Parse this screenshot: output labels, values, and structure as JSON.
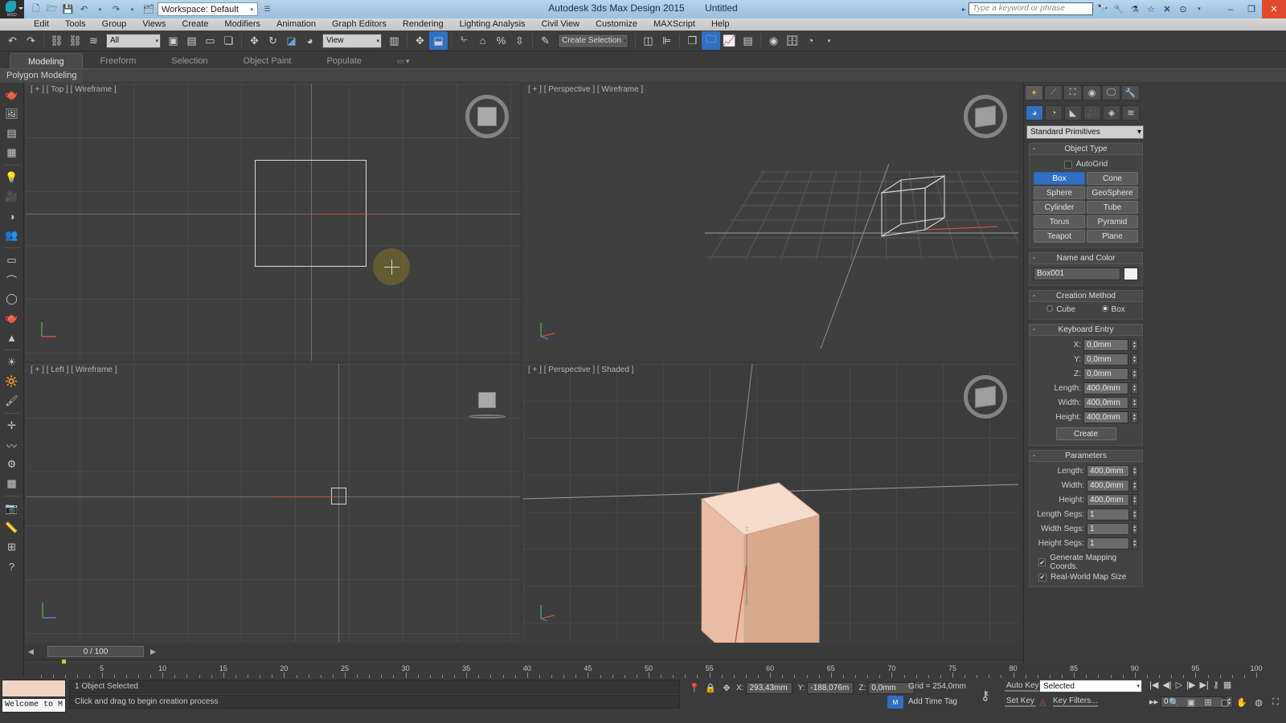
{
  "app": {
    "title": "Autodesk 3ds Max Design 2015",
    "document": "Untitled",
    "logo_label": "MXD"
  },
  "quick_access": {
    "workspace_label": "Workspace: Default",
    "icons": [
      "new-file-icon",
      "open-file-icon",
      "save-icon",
      "undo-icon",
      "redo-icon",
      "project-folder-icon"
    ]
  },
  "search": {
    "placeholder": "Type a keyword or phrase",
    "icons": [
      "binoculars-icon",
      "wrench-icon",
      "subscription-icon",
      "favorites-star-icon",
      "exchange-icon",
      "help-icon"
    ]
  },
  "window_controls": {
    "minimize": "–",
    "maximize": "❐",
    "close": "✕"
  },
  "menu": {
    "items": [
      "Edit",
      "Tools",
      "Group",
      "Views",
      "Create",
      "Modifiers",
      "Animation",
      "Graph Editors",
      "Rendering",
      "Lighting Analysis",
      "Civil View",
      "Customize",
      "MAXScript",
      "Help"
    ]
  },
  "toolbar": {
    "selection_filter": "All",
    "reference_coord": "View",
    "named_selection_set": "Create Selection Set",
    "snap_toggle_value": "3",
    "icons": [
      "undo-icon",
      "redo-icon",
      "select-link-icon",
      "unlink-icon",
      "bind-space-warp-icon",
      "select-object-icon",
      "select-by-name-icon",
      "rectangular-region-icon",
      "window-crossing-icon",
      "select-and-move-icon",
      "select-and-rotate-icon",
      "select-and-scale-icon",
      "select-and-place-icon",
      "use-pivot-center-icon",
      "select-and-manipulate-icon",
      "snaps-toggle-icon",
      "angle-snap-icon",
      "percent-snap-icon",
      "spinner-snap-icon",
      "edit-named-selection-icon",
      "mirror-icon",
      "align-icon",
      "layer-manager-icon",
      "scene-explorer-icon",
      "curve-editor-icon",
      "schematic-view-icon",
      "material-editor-icon",
      "render-setup-icon",
      "render-frame-window-icon",
      "render-production-icon"
    ]
  },
  "ribbon": {
    "tabs": [
      "Modeling",
      "Freeform",
      "Selection",
      "Object Paint",
      "Populate"
    ],
    "active_tab": "Modeling",
    "panel_label": "Polygon Modeling"
  },
  "left_toolbar": {
    "icons": [
      "teapot-icon",
      "render-preview-icon",
      "scene-panel-icon",
      "spreadsheet-icon",
      "light-icon",
      "camera-icon",
      "shade-icon",
      "people-icon",
      "plane-icon",
      "dome-icon",
      "sphere-icon",
      "teapot2-icon",
      "cone-icon",
      "sun-icon",
      "daylight-icon",
      "paint-icon",
      "helper-icon",
      "space-warp-icon",
      "systems-icon",
      "grid-icon",
      "snapshot-icon",
      "measure-icon",
      "array-icon",
      "help2-icon"
    ]
  },
  "viewports": [
    {
      "id": "vp-top",
      "label": "[ + ] [ Top ] [ Wireframe ]",
      "active": true
    },
    {
      "id": "vp-persp",
      "label": "[ + ] [ Perspective ] [ Wireframe ]",
      "active": false
    },
    {
      "id": "vp-left",
      "label": "[ + ] [ Left ] [ Wireframe ]",
      "active": false
    },
    {
      "id": "vp-shaded",
      "label": "[ + ] [ Perspective ] [ Shaded ]",
      "active": false
    }
  ],
  "command_panel": {
    "tabs": [
      "create-tab",
      "modify-tab",
      "hierarchy-tab",
      "motion-tab",
      "display-tab",
      "utilities-tab"
    ],
    "active_tab_index": 0,
    "subcategories": [
      "geometry-icon",
      "shapes-icon",
      "lights-icon",
      "cameras-icon",
      "helpers-icon",
      "space-warps-icon"
    ],
    "active_subcategory_index": 0,
    "category_dropdown": "Standard Primitives",
    "object_type": {
      "title": "Object Type",
      "autogrid_label": "AutoGrid",
      "autogrid_checked": false,
      "buttons": [
        "Box",
        "Cone",
        "Sphere",
        "GeoSphere",
        "Cylinder",
        "Tube",
        "Torus",
        "Pyramid",
        "Teapot",
        "Plane"
      ],
      "selected": "Box"
    },
    "name_and_color": {
      "title": "Name and Color",
      "name": "Box001",
      "color": "#ffffff"
    },
    "creation_method": {
      "title": "Creation Method",
      "options": [
        "Cube",
        "Box"
      ],
      "selected": "Box"
    },
    "keyboard_entry": {
      "title": "Keyboard Entry",
      "fields": [
        {
          "label": "X:",
          "value": "0,0mm"
        },
        {
          "label": "Y:",
          "value": "0,0mm"
        },
        {
          "label": "Z:",
          "value": "0,0mm"
        },
        {
          "label": "Length:",
          "value": "400,0mm"
        },
        {
          "label": "Width:",
          "value": "400,0mm"
        },
        {
          "label": "Height:",
          "value": "400,0mm"
        }
      ],
      "create_label": "Create"
    },
    "parameters": {
      "title": "Parameters",
      "fields": [
        {
          "label": "Length:",
          "value": "400,0mm"
        },
        {
          "label": "Width:",
          "value": "400,0mm"
        },
        {
          "label": "Height:",
          "value": "400,0mm"
        },
        {
          "label": "Length Segs:",
          "value": "1"
        },
        {
          "label": "Width Segs:",
          "value": "1"
        },
        {
          "label": "Height Segs:",
          "value": "1"
        }
      ],
      "checkboxes": [
        {
          "label": "Generate Mapping Coords.",
          "checked": true
        },
        {
          "label": "Real-World Map Size",
          "checked": true
        }
      ]
    }
  },
  "time_slider": {
    "current": "0 / 100",
    "prev_arrow": "◀",
    "next_arrow": "▶"
  },
  "ruler": {
    "labels": [
      "5",
      "10",
      "15",
      "20",
      "25",
      "30",
      "35",
      "40",
      "45",
      "50",
      "55",
      "60",
      "65",
      "70",
      "75",
      "80",
      "85",
      "90",
      "95",
      "100"
    ]
  },
  "status_bar": {
    "max_listener_text": "Welcome to M",
    "selection_status": "1 Object Selected",
    "prompt": "Click and drag to begin creation process",
    "coordinates": [
      {
        "label": "X:",
        "value": "293,43mm"
      },
      {
        "label": "Y:",
        "value": "-188,076m"
      },
      {
        "label": "Z:",
        "value": "0,0mm"
      }
    ],
    "grid": "Grid = 254,0mm",
    "add_time_tag": "Add Time Tag",
    "lock_icon": "lock-selection-icon",
    "pin_icon": "pin-stack-icon",
    "absolute_mode_icon": "absolute-mode-transform-icon"
  },
  "animation": {
    "auto_key": "Auto Key",
    "set_key": "Set Key",
    "selection_list": "Selected",
    "key_filters": "Key Filters...",
    "frame_value": "0",
    "playback_icons": [
      "go-to-start-icon",
      "previous-frame-icon",
      "play-animation-icon",
      "next-frame-icon",
      "go-to-end-icon",
      "key-mode-toggle-icon",
      "time-configuration-icon"
    ],
    "nav_icons": [
      "zoom-icon",
      "zoom-all-icon",
      "zoom-extents-icon",
      "zoom-region-icon",
      "pan-view-icon",
      "orbit-icon",
      "maximize-viewport-icon"
    ]
  },
  "colors": {
    "accent_blue": "#2f6fc4",
    "titlebar": "#a8c9e4",
    "panel_bg": "#3c3c3c",
    "viewport_bg": "#3f3f3f",
    "active_viewport_border": "#b8b05a",
    "cube_light": "#f4d7c4",
    "cube_mid": "#e3b99f",
    "close_button": "#e04a2f"
  }
}
